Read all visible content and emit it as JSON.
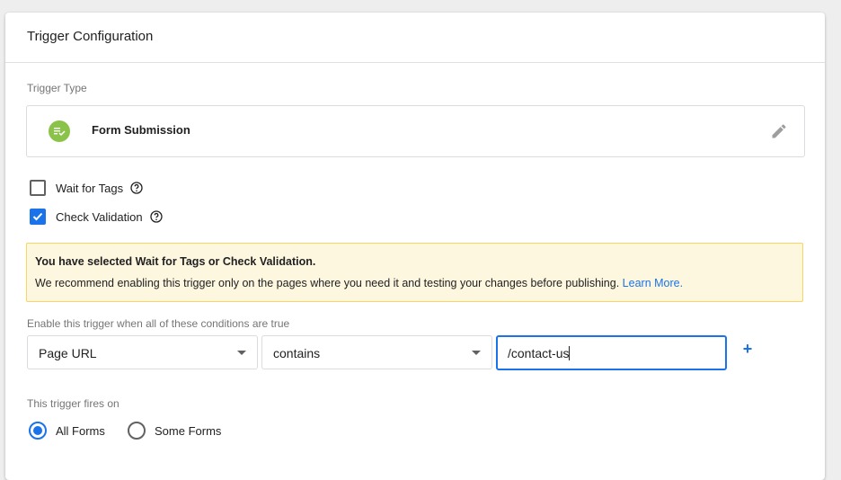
{
  "header": {
    "title": "Trigger Configuration"
  },
  "trigger_type": {
    "section_label": "Trigger Type",
    "name": "Form Submission",
    "icon": "form-submission-icon",
    "icon_color": "#8bc34a"
  },
  "options": {
    "wait_for_tags": {
      "label": "Wait for Tags",
      "checked": false
    },
    "check_validation": {
      "label": "Check Validation",
      "checked": true
    }
  },
  "warning": {
    "title": "You have selected Wait for Tags or Check Validation.",
    "body": "We recommend enabling this trigger only on the pages where you need it and testing your changes before publishing.",
    "link": "Learn More."
  },
  "conditions": {
    "label": "Enable this trigger when all of these conditions are true",
    "variable": "Page URL",
    "operator": "contains",
    "value": "/contact-us",
    "add_label": "+"
  },
  "fires_on": {
    "label": "This trigger fires on",
    "options": [
      {
        "label": "All Forms",
        "selected": true
      },
      {
        "label": "Some Forms",
        "selected": false
      }
    ]
  },
  "colors": {
    "accent": "#1a73e8",
    "warning_bg": "#fef7e0",
    "warning_border": "#f9d563"
  }
}
